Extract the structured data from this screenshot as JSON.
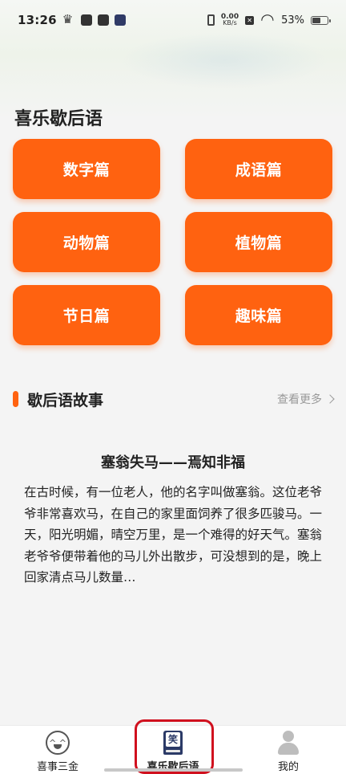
{
  "status_bar": {
    "time": "13:26",
    "net_speed_value": "0.00",
    "net_speed_unit": "KB/s",
    "battery": "53%"
  },
  "page": {
    "title": "喜乐歇后语"
  },
  "categories": [
    {
      "label": "数字篇"
    },
    {
      "label": "成语篇"
    },
    {
      "label": "动物篇"
    },
    {
      "label": "植物篇"
    },
    {
      "label": "节日篇"
    },
    {
      "label": "趣味篇"
    }
  ],
  "stories_section": {
    "title": "歇后语故事",
    "more_label": "查看更多"
  },
  "story": {
    "title": "塞翁失马——焉知非福",
    "body": "在古时候，有一位老人，他的名字叫做塞翁。这位老爷爷非常喜欢马，在自己的家里面饲养了很多匹骏马。一天，阳光明媚，晴空万里，是一个难得的好天气。塞翁老爷爷便带着他的马儿外出散步，可没想到的是，晚上回家清点马儿数量…"
  },
  "tabbar": {
    "tabs": [
      {
        "label": "喜事三金",
        "icon": "smile-icon"
      },
      {
        "label": "喜乐歇后语",
        "icon": "book-icon",
        "icon_glyph": "笑"
      },
      {
        "label": "我的",
        "icon": "person-icon"
      }
    ],
    "active_index": 1
  },
  "colors": {
    "accent": "#ff6210",
    "highlight": "#d0101e",
    "book": "#2b3a67"
  }
}
